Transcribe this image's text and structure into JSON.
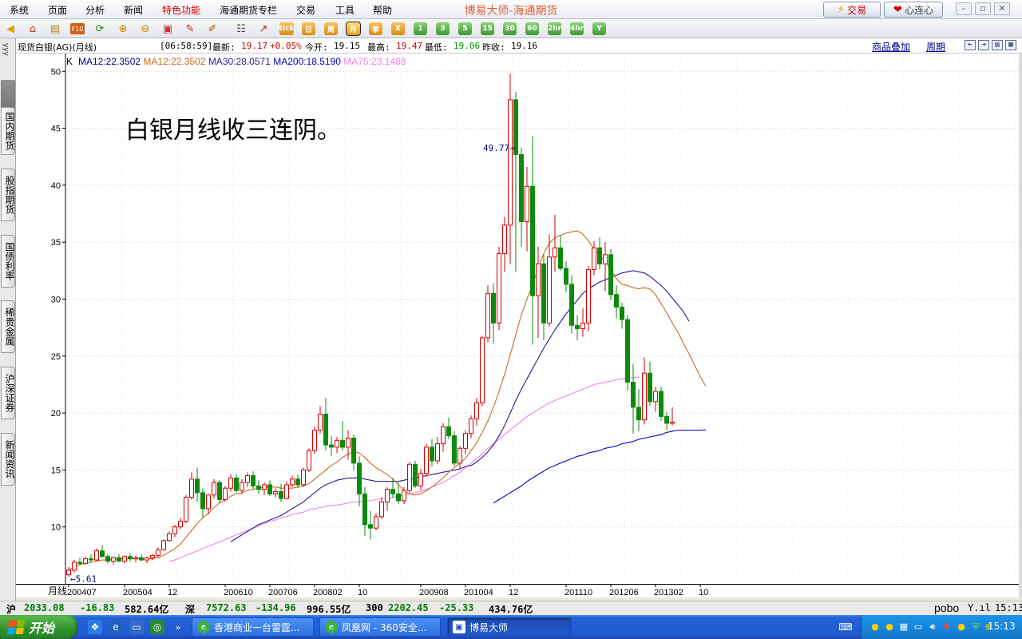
{
  "menubar": {
    "items": [
      {
        "label": "系统",
        "special": false
      },
      {
        "label": "页面",
        "special": false
      },
      {
        "label": "分析",
        "special": false
      },
      {
        "label": "新闻",
        "special": false
      },
      {
        "label": "特色功能",
        "special": true
      },
      {
        "label": "海通期货专栏",
        "special": false
      },
      {
        "label": "交易",
        "special": false
      },
      {
        "label": "工具",
        "special": false
      },
      {
        "label": "帮助",
        "special": false
      }
    ],
    "app_title": "博易大师-海通期货",
    "trade_button": "交易",
    "heart_button": "心连心"
  },
  "toolbar": {
    "period_buttons": [
      "tick",
      "日",
      "周",
      "月",
      "季",
      "X",
      "1",
      "3",
      "5",
      "15",
      "30",
      "60",
      "2hr",
      "4hr",
      "Y"
    ],
    "active_period": "月"
  },
  "left_tabs": [
    "国内期货",
    "股指期货",
    "国债利率",
    "稀贵金属",
    "沪深证券",
    "新闻资讯"
  ],
  "left_tabs_top_text": "yyy",
  "infobar": {
    "instrument": "现货白银(AG)(月线)",
    "time": "[06:58:59]",
    "latest_label": "最新:",
    "latest": "19.17",
    "change": "+0.05%",
    "open_label": "今开:",
    "open": "19.15",
    "high_label": "最高:",
    "high": "19.47",
    "low_label": "最低:",
    "low": "19.06",
    "prev_label": "昨收:",
    "prev": "19.16",
    "overlay_link": "商品叠加",
    "period_link": "周期"
  },
  "colors": {
    "up": "#d40000",
    "down": "#0b8a0b",
    "ma12": "#d2691e",
    "ma30": "#2a1a9a",
    "ma200": "#0000cd",
    "ma75": "#ee82ee"
  },
  "chart_data": {
    "type": "candlestick",
    "period": "月线",
    "legend_prefix": "K",
    "legend": [
      {
        "name": "MA12",
        "value": "22.3502",
        "color": "#000080"
      },
      {
        "name": "MA12",
        "value": "22.3502",
        "color": "#d2691e"
      },
      {
        "name": "MA30",
        "value": "28.0571",
        "color": "#2a1a9a"
      },
      {
        "name": "MA200",
        "value": "18.5190",
        "color": "#0000cd"
      },
      {
        "name": "MA75",
        "value": "23.1488",
        "color": "#ee82ee"
      }
    ],
    "annotation": "白银月线收三连阴。",
    "y_ticks": [
      10,
      15,
      20,
      25,
      30,
      35,
      40,
      45,
      50
    ],
    "ylim": [
      5,
      51
    ],
    "x_tick_labels": [
      {
        "index": 0,
        "label": "200407"
      },
      {
        "index": 10,
        "label": "200504"
      },
      {
        "index": 18,
        "label": "12"
      },
      {
        "index": 28,
        "label": "200610"
      },
      {
        "index": 36,
        "label": "200706"
      },
      {
        "index": 44,
        "label": "200802"
      },
      {
        "index": 52,
        "label": "10"
      },
      {
        "index": 63,
        "label": "200908"
      },
      {
        "index": 71,
        "label": "201004"
      },
      {
        "index": 79,
        "label": "12"
      },
      {
        "index": 89,
        "label": "201110"
      },
      {
        "index": 97,
        "label": "201206"
      },
      {
        "index": 105,
        "label": "201302"
      },
      {
        "index": 113,
        "label": "10"
      }
    ],
    "max_label": "49.77",
    "min_label": "5.61",
    "max_index": 81,
    "min_index": 0,
    "bars": [
      {
        "o": 5.8,
        "h": 6.5,
        "l": 5.61,
        "c": 6.2
      },
      {
        "o": 6.2,
        "h": 7.1,
        "l": 6.0,
        "c": 6.9
      },
      {
        "o": 6.9,
        "h": 7.3,
        "l": 6.6,
        "c": 6.8
      },
      {
        "o": 6.8,
        "h": 7.4,
        "l": 6.7,
        "c": 7.2
      },
      {
        "o": 7.2,
        "h": 7.6,
        "l": 6.9,
        "c": 7.1
      },
      {
        "o": 7.1,
        "h": 8.1,
        "l": 7.0,
        "c": 7.9
      },
      {
        "o": 7.9,
        "h": 8.4,
        "l": 7.3,
        "c": 7.4
      },
      {
        "o": 7.4,
        "h": 7.6,
        "l": 6.8,
        "c": 7.0
      },
      {
        "o": 7.0,
        "h": 7.4,
        "l": 6.7,
        "c": 7.3
      },
      {
        "o": 7.3,
        "h": 7.6,
        "l": 6.9,
        "c": 7.0
      },
      {
        "o": 7.0,
        "h": 7.5,
        "l": 6.8,
        "c": 7.4
      },
      {
        "o": 7.4,
        "h": 7.7,
        "l": 7.0,
        "c": 7.2
      },
      {
        "o": 7.2,
        "h": 7.5,
        "l": 6.9,
        "c": 7.3
      },
      {
        "o": 7.3,
        "h": 7.6,
        "l": 7.0,
        "c": 7.1
      },
      {
        "o": 7.1,
        "h": 7.4,
        "l": 6.8,
        "c": 7.3
      },
      {
        "o": 7.3,
        "h": 7.6,
        "l": 7.1,
        "c": 7.5
      },
      {
        "o": 7.5,
        "h": 8.2,
        "l": 7.3,
        "c": 8.0
      },
      {
        "o": 8.0,
        "h": 8.9,
        "l": 7.9,
        "c": 8.8
      },
      {
        "o": 8.8,
        "h": 9.6,
        "l": 8.7,
        "c": 9.4
      },
      {
        "o": 9.4,
        "h": 10.2,
        "l": 9.1,
        "c": 10.0
      },
      {
        "o": 10.0,
        "h": 10.8,
        "l": 9.8,
        "c": 10.5
      },
      {
        "o": 10.5,
        "h": 12.8,
        "l": 10.3,
        "c": 12.6
      },
      {
        "o": 12.6,
        "h": 14.8,
        "l": 12.4,
        "c": 14.2
      },
      {
        "o": 14.2,
        "h": 15.2,
        "l": 12.2,
        "c": 13.0
      },
      {
        "o": 13.0,
        "h": 13.4,
        "l": 10.8,
        "c": 11.6
      },
      {
        "o": 11.6,
        "h": 12.9,
        "l": 11.1,
        "c": 12.8
      },
      {
        "o": 12.8,
        "h": 14.2,
        "l": 12.5,
        "c": 13.9
      },
      {
        "o": 13.9,
        "h": 14.1,
        "l": 12.1,
        "c": 12.4
      },
      {
        "o": 12.4,
        "h": 13.6,
        "l": 12.2,
        "c": 13.4
      },
      {
        "o": 13.4,
        "h": 14.6,
        "l": 13.1,
        "c": 14.3
      },
      {
        "o": 14.3,
        "h": 14.6,
        "l": 13.0,
        "c": 13.2
      },
      {
        "o": 13.2,
        "h": 14.2,
        "l": 12.9,
        "c": 13.9
      },
      {
        "o": 13.9,
        "h": 14.8,
        "l": 13.5,
        "c": 14.5
      },
      {
        "o": 14.5,
        "h": 14.9,
        "l": 13.3,
        "c": 13.6
      },
      {
        "o": 13.6,
        "h": 14.1,
        "l": 12.9,
        "c": 13.3
      },
      {
        "o": 13.3,
        "h": 13.9,
        "l": 12.8,
        "c": 13.7
      },
      {
        "o": 13.7,
        "h": 14.1,
        "l": 12.7,
        "c": 12.9
      },
      {
        "o": 12.9,
        "h": 13.4,
        "l": 12.6,
        "c": 13.1
      },
      {
        "o": 13.1,
        "h": 13.8,
        "l": 12.2,
        "c": 12.5
      },
      {
        "o": 12.5,
        "h": 14.0,
        "l": 12.4,
        "c": 13.7
      },
      {
        "o": 13.7,
        "h": 14.5,
        "l": 13.5,
        "c": 14.2
      },
      {
        "o": 14.2,
        "h": 14.6,
        "l": 13.4,
        "c": 13.7
      },
      {
        "o": 13.7,
        "h": 15.2,
        "l": 13.5,
        "c": 15.0
      },
      {
        "o": 15.0,
        "h": 16.9,
        "l": 14.8,
        "c": 16.7
      },
      {
        "o": 16.7,
        "h": 18.8,
        "l": 16.4,
        "c": 18.5
      },
      {
        "o": 18.5,
        "h": 20.6,
        "l": 18.2,
        "c": 19.9
      },
      {
        "o": 19.9,
        "h": 21.3,
        "l": 16.7,
        "c": 17.2
      },
      {
        "o": 17.2,
        "h": 18.0,
        "l": 16.2,
        "c": 17.0
      },
      {
        "o": 17.0,
        "h": 17.9,
        "l": 16.5,
        "c": 17.6
      },
      {
        "o": 17.6,
        "h": 19.3,
        "l": 16.7,
        "c": 17.0
      },
      {
        "o": 17.0,
        "h": 18.5,
        "l": 15.9,
        "c": 17.8
      },
      {
        "o": 17.8,
        "h": 18.1,
        "l": 15.0,
        "c": 15.6
      },
      {
        "o": 15.6,
        "h": 16.2,
        "l": 11.8,
        "c": 12.9
      },
      {
        "o": 12.9,
        "h": 13.5,
        "l": 9.2,
        "c": 10.2
      },
      {
        "o": 10.2,
        "h": 11.4,
        "l": 8.9,
        "c": 9.9
      },
      {
        "o": 9.9,
        "h": 11.2,
        "l": 9.7,
        "c": 10.9
      },
      {
        "o": 10.9,
        "h": 12.6,
        "l": 10.7,
        "c": 12.2
      },
      {
        "o": 12.2,
        "h": 13.5,
        "l": 11.4,
        "c": 13.3
      },
      {
        "o": 13.3,
        "h": 14.3,
        "l": 12.6,
        "c": 12.9
      },
      {
        "o": 12.9,
        "h": 13.9,
        "l": 12.0,
        "c": 12.3
      },
      {
        "o": 12.3,
        "h": 13.5,
        "l": 12.0,
        "c": 13.2
      },
      {
        "o": 13.2,
        "h": 15.7,
        "l": 13.0,
        "c": 15.5
      },
      {
        "o": 15.5,
        "h": 15.8,
        "l": 13.4,
        "c": 13.6
      },
      {
        "o": 13.6,
        "h": 15.1,
        "l": 13.2,
        "c": 14.7
      },
      {
        "o": 14.7,
        "h": 17.3,
        "l": 14.4,
        "c": 17.0
      },
      {
        "o": 17.0,
        "h": 17.7,
        "l": 15.3,
        "c": 15.8
      },
      {
        "o": 15.8,
        "h": 17.9,
        "l": 15.5,
        "c": 17.3
      },
      {
        "o": 17.3,
        "h": 19.1,
        "l": 16.6,
        "c": 18.8
      },
      {
        "o": 18.8,
        "h": 19.6,
        "l": 17.7,
        "c": 18.0
      },
      {
        "o": 18.0,
        "h": 18.4,
        "l": 15.3,
        "c": 15.6
      },
      {
        "o": 15.6,
        "h": 17.1,
        "l": 15.1,
        "c": 16.9
      },
      {
        "o": 16.9,
        "h": 18.5,
        "l": 16.4,
        "c": 18.2
      },
      {
        "o": 18.2,
        "h": 19.8,
        "l": 17.8,
        "c": 19.5
      },
      {
        "o": 19.5,
        "h": 21.3,
        "l": 18.9,
        "c": 20.9
      },
      {
        "o": 20.9,
        "h": 26.8,
        "l": 20.6,
        "c": 26.6
      },
      {
        "o": 26.6,
        "h": 31.2,
        "l": 26.2,
        "c": 30.5
      },
      {
        "o": 30.5,
        "h": 31.4,
        "l": 26.1,
        "c": 27.9
      },
      {
        "o": 27.9,
        "h": 34.6,
        "l": 27.3,
        "c": 34.0
      },
      {
        "o": 34.0,
        "h": 37.2,
        "l": 32.4,
        "c": 36.5
      },
      {
        "o": 36.5,
        "h": 49.77,
        "l": 33.1,
        "c": 47.5
      },
      {
        "o": 47.5,
        "h": 48.2,
        "l": 32.4,
        "c": 42.7
      },
      {
        "o": 42.7,
        "h": 43.3,
        "l": 34.6,
        "c": 36.8
      },
      {
        "o": 36.8,
        "h": 41.6,
        "l": 34.2,
        "c": 39.9
      },
      {
        "o": 39.9,
        "h": 44.3,
        "l": 26.0,
        "c": 30.3
      },
      {
        "o": 30.3,
        "h": 34.6,
        "l": 26.6,
        "c": 33.1
      },
      {
        "o": 33.1,
        "h": 33.9,
        "l": 26.4,
        "c": 27.9
      },
      {
        "o": 27.9,
        "h": 35.7,
        "l": 27.6,
        "c": 33.7
      },
      {
        "o": 33.7,
        "h": 37.4,
        "l": 32.4,
        "c": 34.5
      },
      {
        "o": 34.5,
        "h": 35.6,
        "l": 32.5,
        "c": 32.7
      },
      {
        "o": 32.7,
        "h": 33.3,
        "l": 30.6,
        "c": 31.3
      },
      {
        "o": 31.3,
        "h": 32.1,
        "l": 27.0,
        "c": 27.7
      },
      {
        "o": 27.7,
        "h": 28.6,
        "l": 26.4,
        "c": 27.4
      },
      {
        "o": 27.4,
        "h": 29.2,
        "l": 26.7,
        "c": 27.9
      },
      {
        "o": 27.9,
        "h": 32.9,
        "l": 27.2,
        "c": 32.6
      },
      {
        "o": 32.6,
        "h": 35.1,
        "l": 32.1,
        "c": 34.5
      },
      {
        "o": 34.5,
        "h": 35.4,
        "l": 32.6,
        "c": 33.1
      },
      {
        "o": 33.1,
        "h": 35.0,
        "l": 30.7,
        "c": 33.9
      },
      {
        "o": 33.9,
        "h": 34.4,
        "l": 29.9,
        "c": 30.4
      },
      {
        "o": 30.4,
        "h": 31.2,
        "l": 28.3,
        "c": 29.3
      },
      {
        "o": 29.3,
        "h": 29.7,
        "l": 27.4,
        "c": 28.2
      },
      {
        "o": 28.2,
        "h": 28.6,
        "l": 22.0,
        "c": 22.7
      },
      {
        "o": 22.7,
        "h": 24.3,
        "l": 18.2,
        "c": 20.5
      },
      {
        "o": 20.5,
        "h": 22.1,
        "l": 18.4,
        "c": 19.4
      },
      {
        "o": 19.4,
        "h": 24.9,
        "l": 19.0,
        "c": 23.5
      },
      {
        "o": 23.5,
        "h": 24.5,
        "l": 20.6,
        "c": 21.0
      },
      {
        "o": 21.0,
        "h": 22.3,
        "l": 20.1,
        "c": 21.9
      },
      {
        "o": 21.9,
        "h": 22.3,
        "l": 19.3,
        "c": 19.7
      },
      {
        "o": 19.7,
        "h": 20.1,
        "l": 18.5,
        "c": 19.1
      },
      {
        "o": 19.1,
        "h": 20.5,
        "l": 18.9,
        "c": 19.2
      }
    ],
    "ma12": [
      6.2,
      6.5,
      6.7,
      6.8,
      6.9,
      7.0,
      7.1,
      7.1,
      7.2,
      7.2,
      7.2,
      7.2,
      7.2,
      7.2,
      7.2,
      7.2,
      7.3,
      7.5,
      7.8,
      8.1,
      8.5,
      9.1,
      9.7,
      10.3,
      10.8,
      11.2,
      11.7,
      12.1,
      12.4,
      12.7,
      12.9,
      13.0,
      13.2,
      13.3,
      13.4,
      13.5,
      13.5,
      13.5,
      13.4,
      13.4,
      13.4,
      13.5,
      13.6,
      13.8,
      14.2,
      14.6,
      15.0,
      15.4,
      15.7,
      16.1,
      16.4,
      16.6,
      16.5,
      16.1,
      15.6,
      15.2,
      14.9,
      14.6,
      14.2,
      13.7,
      13.2,
      12.9,
      12.8,
      12.9,
      13.2,
      13.5,
      13.9,
      14.3,
      14.8,
      15.2,
      15.6,
      16.0,
      16.7,
      17.4,
      18.3,
      19.3,
      20.5,
      21.9,
      23.4,
      25.1,
      26.9,
      28.6,
      30.0,
      31.3,
      32.7,
      34.0,
      34.9,
      35.4,
      35.6,
      35.8,
      35.9,
      36.0,
      35.7,
      35.1,
      34.4,
      33.8,
      33.3,
      32.6,
      31.8,
      31.3,
      31.2,
      31.0,
      30.9,
      31.0,
      30.9,
      30.4,
      29.6,
      28.8,
      27.9,
      27.1,
      26.1,
      25.2,
      24.2,
      23.2,
      22.35
    ],
    "ma30": [
      null,
      null,
      null,
      null,
      null,
      null,
      null,
      null,
      null,
      null,
      null,
      null,
      null,
      null,
      null,
      null,
      null,
      null,
      null,
      null,
      null,
      null,
      null,
      null,
      null,
      null,
      null,
      null,
      null,
      8.7,
      9.0,
      9.3,
      9.6,
      9.9,
      10.2,
      10.4,
      10.6,
      10.8,
      11.0,
      11.3,
      11.6,
      11.9,
      12.2,
      12.6,
      13.0,
      13.4,
      13.7,
      13.9,
      14.1,
      14.2,
      14.3,
      14.3,
      14.3,
      14.2,
      14.1,
      14.0,
      14.0,
      14.0,
      14.0,
      14.0,
      14.1,
      14.2,
      14.3,
      14.4,
      14.5,
      14.6,
      14.7,
      14.8,
      14.9,
      15.0,
      15.1,
      15.3,
      15.4,
      15.7,
      16.1,
      16.6,
      17.2,
      18.0,
      18.9,
      20.0,
      21.1,
      22.1,
      23.0,
      23.9,
      24.8,
      25.7,
      26.5,
      27.3,
      28.0,
      28.7,
      29.3,
      29.9,
      30.5,
      30.9,
      31.2,
      31.5,
      31.7,
      31.9,
      32.1,
      32.3,
      32.4,
      32.5,
      32.4,
      32.3,
      32.0,
      31.6,
      31.2,
      30.7,
      30.1,
      29.5,
      28.9,
      28.06
    ],
    "ma200": [
      null,
      null,
      null,
      null,
      null,
      null,
      null,
      null,
      null,
      null,
      null,
      null,
      null,
      null,
      null,
      null,
      null,
      null,
      null,
      null,
      null,
      null,
      null,
      null,
      null,
      null,
      null,
      null,
      null,
      null,
      null,
      null,
      null,
      null,
      null,
      null,
      null,
      null,
      null,
      null,
      null,
      null,
      null,
      null,
      null,
      null,
      null,
      null,
      null,
      null,
      null,
      null,
      null,
      null,
      null,
      null,
      null,
      null,
      null,
      null,
      null,
      null,
      null,
      null,
      null,
      null,
      null,
      null,
      null,
      null,
      null,
      null,
      null,
      null,
      null,
      null,
      12.1,
      12.4,
      12.7,
      13.0,
      13.3,
      13.6,
      14.0,
      14.3,
      14.6,
      14.9,
      15.2,
      15.4,
      15.6,
      15.8,
      16.0,
      16.2,
      16.3,
      16.5,
      16.6,
      16.7,
      16.9,
      17.0,
      17.1,
      17.3,
      17.4,
      17.5,
      17.7,
      17.8,
      17.9,
      18.0,
      18.1,
      18.3,
      18.4,
      18.5,
      18.5,
      18.5,
      18.5,
      18.5,
      18.52
    ],
    "ma75": [
      null,
      null,
      null,
      null,
      null,
      null,
      null,
      null,
      null,
      null,
      null,
      null,
      null,
      null,
      null,
      null,
      null,
      null,
      7.0,
      7.1,
      7.3,
      7.5,
      7.7,
      7.9,
      8.1,
      8.3,
      8.5,
      8.7,
      8.9,
      9.1,
      9.3,
      9.5,
      9.7,
      9.9,
      10.1,
      10.3,
      10.5,
      10.6,
      10.8,
      10.9,
      11.1,
      11.2,
      11.3,
      11.5,
      11.6,
      11.7,
      11.8,
      11.9,
      11.9,
      12.0,
      12.1,
      12.2,
      12.2,
      12.3,
      12.3,
      12.4,
      12.5,
      12.5,
      12.6,
      12.7,
      12.8,
      12.9,
      13.0,
      13.1,
      13.3,
      13.5,
      13.7,
      13.9,
      14.2,
      14.5,
      14.8,
      15.2,
      15.6,
      16.0,
      16.4,
      16.9,
      17.3,
      17.7,
      18.1,
      18.5,
      18.9,
      19.3,
      19.7,
      20.0,
      20.3,
      20.6,
      20.9,
      21.1,
      21.3,
      21.5,
      21.7,
      21.9,
      22.1,
      22.3,
      22.5,
      22.6,
      22.7,
      22.8,
      22.9,
      23.0,
      23.1,
      23.1,
      23.15
    ]
  },
  "statusbar": {
    "sh_label": "沪",
    "sh_value": "2033.08",
    "sh_change": "-16.83",
    "sh_amount": "582.64亿",
    "sz_label": "深",
    "sz_value": "7572.63",
    "sz_change": "-134.96",
    "sz_amount": "996.55亿",
    "hs_label": "300",
    "hs_value": "2202.45",
    "hs_change": "-25.33",
    "hs_amount": "434.76亿",
    "brand": "pobo",
    "signal": "Y.ıl",
    "time": "15:13"
  },
  "taskbar": {
    "start_label": "开始",
    "tasks": [
      {
        "label": "香港商业一台雷霆...",
        "active": false
      },
      {
        "label": "凤凰网 - 360安全...",
        "active": false
      },
      {
        "label": "博易大师",
        "active": true
      }
    ],
    "clock": "15:13"
  }
}
